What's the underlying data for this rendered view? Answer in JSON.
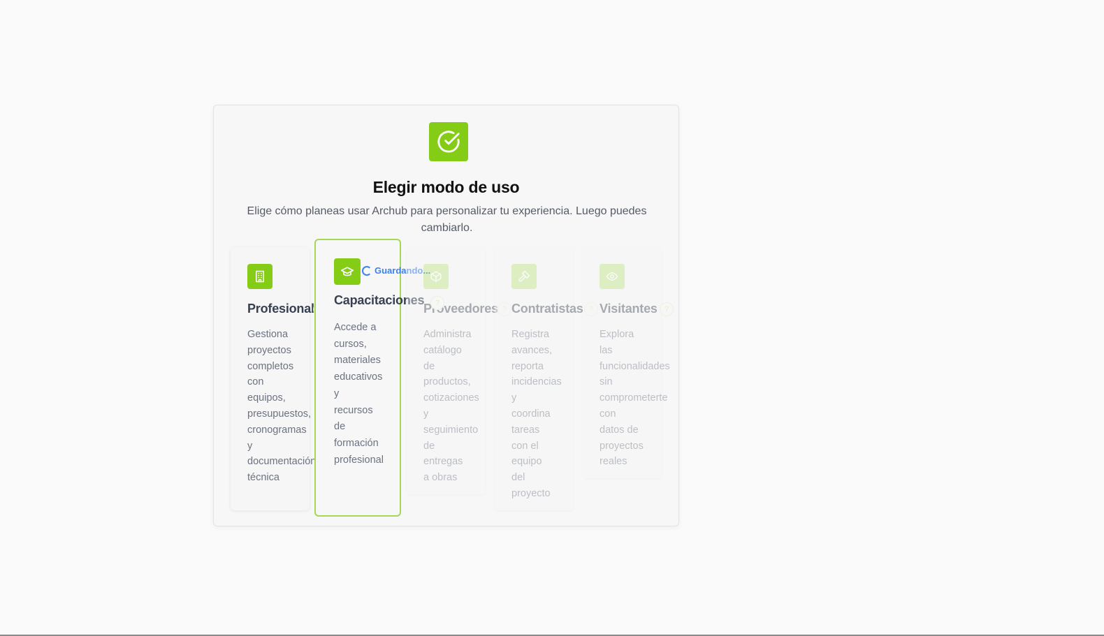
{
  "dialog": {
    "title": "Elegir modo de uso",
    "subtitle": "Elige cómo planeas usar Archub para personalizar tu experiencia. Luego puedes cambiarlo.",
    "header_icon": "check-circle-icon"
  },
  "cards": [
    {
      "title": "Profesional",
      "icon": "building-icon",
      "description": "Gestiona\nproyectos\ncompletos\ncon\nequipos,\npresupuestos,\ncronogramas\ny\ndocumentación\ntécnica",
      "state": "normal"
    },
    {
      "title": "Capacitaciones",
      "icon": "graduation-cap-icon",
      "description": "Accede a\ncursos,\nmateriales\neducativos\ny\nrecursos\nde\nformación\nprofesional",
      "state": "selected",
      "status": "Guardando..."
    },
    {
      "title": "Proveedores",
      "icon": "package-icon",
      "description": "Administra\ncatálogo\nde\nproductos,\ncotizaciones\ny\nseguimiento\nde\nentregas\na obras",
      "state": "faded"
    },
    {
      "title": "Contratistas",
      "icon": "hammer-icon",
      "description": "Registra\navances,\nreporta\nincidencias\ny\ncoordina\ntareas\ncon el\nequipo\ndel\nproyecto",
      "state": "faded"
    },
    {
      "title": "Visitantes",
      "icon": "eye-icon",
      "description": "Explora\nlas\nfuncionalidades\nsin\ncomprometerte\ncon\ndatos de\nproyectos\nreales",
      "state": "faded"
    }
  ],
  "help_glyph": "?",
  "colors": {
    "accent": "#84cc16",
    "status": "#3b82f6"
  }
}
